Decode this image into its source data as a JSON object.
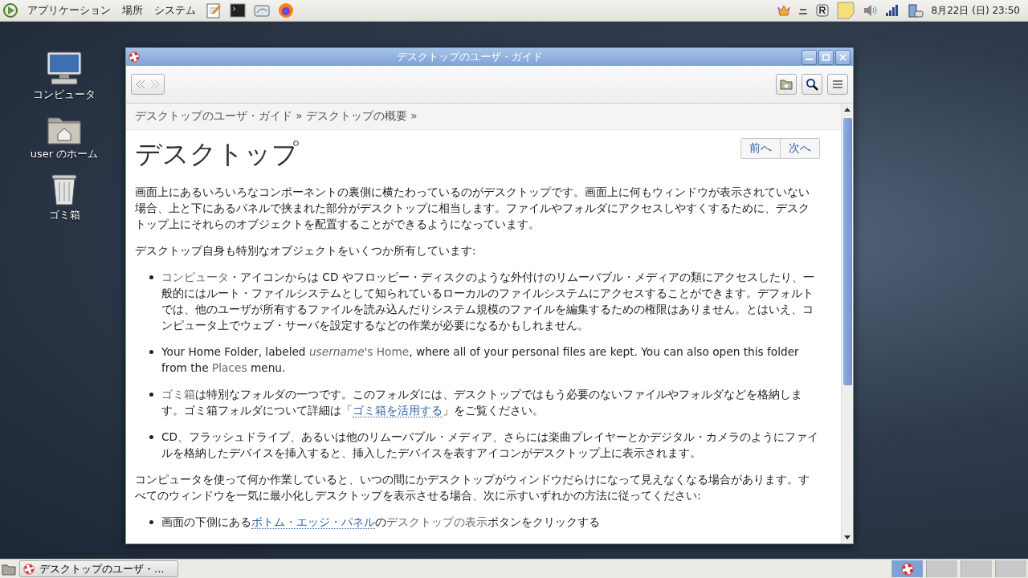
{
  "top_panel": {
    "menus": [
      "アプリケーション",
      "場所",
      "システム"
    ],
    "clock": "8月22日 (日) 23:50"
  },
  "desktop_icons": [
    {
      "kind": "computer",
      "label": "コンピュータ"
    },
    {
      "kind": "home",
      "label": "user のホーム"
    },
    {
      "kind": "trash",
      "label": "ゴミ箱"
    }
  ],
  "window": {
    "title": "デスクトップのユーザ・ガイド",
    "breadcrumb": "デスクトップのユーザ・ガイド » デスクトップの概要 »",
    "heading": "デスクトップ",
    "nav_buttons": [
      "前へ",
      "次へ"
    ],
    "blocks": [
      {
        "kind": "para",
        "segments": [
          {
            "kind": "plain",
            "text": "画面上にあるいろいろなコンポーネントの裏側に横たわっているのがデスクトップです。画面上に何もウィンドウが表示されていない場合、上と下にあるパネルで挟まれた部分がデスクトップに相当します。ファイルやフォルダにアクセスしやすくするために、デスクトップ上にそれらのオブジェクトを配置することができるようになっています。"
          }
        ]
      },
      {
        "kind": "para",
        "segments": [
          {
            "kind": "plain",
            "text": "デスクトップ自身も特別なオブジェクトをいくつか所有しています:"
          }
        ]
      },
      {
        "kind": "bullet",
        "segments": [
          {
            "kind": "term",
            "text": "コンピュータ"
          },
          {
            "kind": "plain",
            "text": "・アイコンからは CD やフロッピー・ディスクのような外付けのリムーバブル・メディアの類にアクセスしたり、一般的にはルート・ファイルシステムとして知られているローカルのファイルシステムにアクセスすることができます。デフォルトでは、他のユーザが所有するファイルを読み込んだりシステム規模のファイルを編集するための権限はありません。とはいえ、コンピュータ上でウェブ・サーバを設定するなどの作業が必要になるかもしれません。"
          }
        ]
      },
      {
        "kind": "bullet",
        "segments": [
          {
            "kind": "plain",
            "text": "Your Home Folder, labeled "
          },
          {
            "kind": "em",
            "text": "username"
          },
          {
            "kind": "term",
            "text": "'s Home"
          },
          {
            "kind": "plain",
            "text": ", where all of your personal files are kept. You can also open this folder from the "
          },
          {
            "kind": "term",
            "text": "Places"
          },
          {
            "kind": "plain",
            "text": " menu."
          }
        ]
      },
      {
        "kind": "bullet",
        "segments": [
          {
            "kind": "term",
            "text": "ゴミ箱"
          },
          {
            "kind": "plain",
            "text": "は特別なフォルダの一つです。このフォルダには、デスクトップではもう必要のないファイルやフォルダなどを格納します。ゴミ箱フォルダについて詳細は「"
          },
          {
            "kind": "link",
            "text": "ゴミ箱を活用する"
          },
          {
            "kind": "plain",
            "text": "」をご覧ください。"
          }
        ]
      },
      {
        "kind": "bullet",
        "segments": [
          {
            "kind": "plain",
            "text": "CD、フラッシュドライブ、あるいは他のリムーバブル・メディア、さらには楽曲プレイヤーとかデジタル・カメラのようにファイルを格納したデバイスを挿入すると、挿入したデバイスを表すアイコンがデスクトップ上に表示されます。"
          }
        ]
      },
      {
        "kind": "para",
        "segments": [
          {
            "kind": "plain",
            "text": "コンピュータを使って何か作業していると、いつの間にかデスクトップがウィンドウだらけになって見えなくなる場合があります。すべてのウィンドウを一気に最小化しデスクトップを表示させる場合、次に示すいずれかの方法に従ってください:"
          }
        ]
      },
      {
        "kind": "bullet",
        "segments": [
          {
            "kind": "plain",
            "text": "画面の下側にある"
          },
          {
            "kind": "link",
            "text": "ボトム・エッジ・パネル"
          },
          {
            "kind": "plain",
            "text": "の"
          },
          {
            "kind": "term",
            "text": "デスクトップの表示"
          },
          {
            "kind": "plain",
            "text": "ボタンをクリックする"
          }
        ]
      }
    ]
  },
  "taskbar": {
    "task": "デスクトップのユーザ・...",
    "workspaces": [
      {
        "selected": true
      },
      {
        "selected": false
      },
      {
        "selected": false
      },
      {
        "selected": false
      }
    ]
  }
}
